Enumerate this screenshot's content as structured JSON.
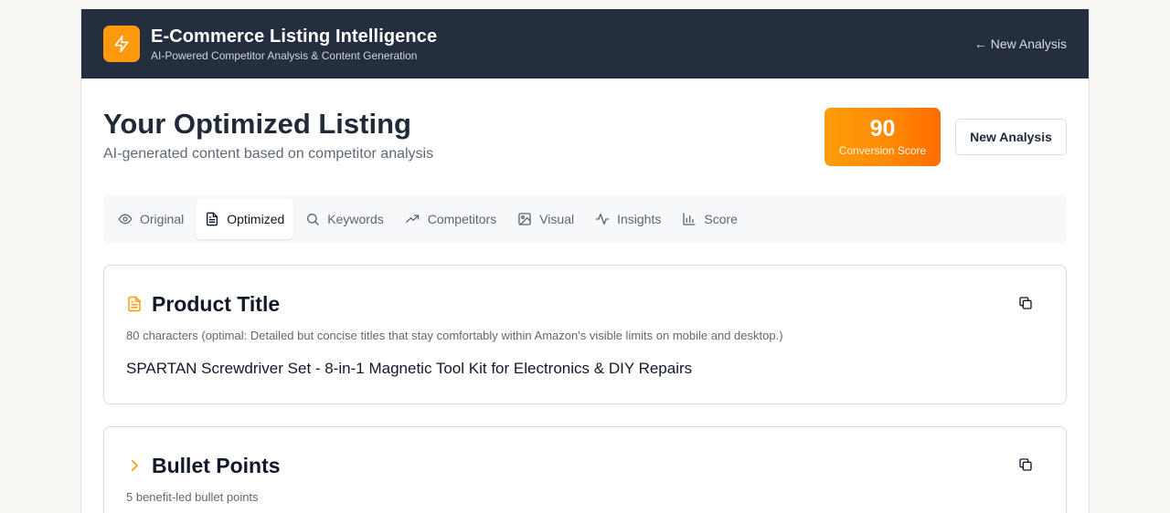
{
  "header": {
    "title": "E-Commerce Listing Intelligence",
    "subtitle": "AI-Powered Competitor Analysis & Content Generation",
    "back_link": "← New Analysis",
    "logo_icon": "lightning-icon"
  },
  "hero": {
    "title": "Your Optimized Listing",
    "subtitle": "AI-generated content based on competitor analysis",
    "score": {
      "value": "90",
      "label": "Conversion Score"
    },
    "new_analysis_button": "New Analysis"
  },
  "tabs": [
    {
      "label": "Original",
      "icon": "eye-icon",
      "active": false
    },
    {
      "label": "Optimized",
      "icon": "document-icon",
      "active": true
    },
    {
      "label": "Keywords",
      "icon": "search-icon",
      "active": false
    },
    {
      "label": "Competitors",
      "icon": "trending-up-icon",
      "active": false
    },
    {
      "label": "Visual",
      "icon": "image-icon",
      "active": false
    },
    {
      "label": "Insights",
      "icon": "activity-icon",
      "active": false
    },
    {
      "label": "Score",
      "icon": "bar-chart-icon",
      "active": false
    }
  ],
  "product_title_card": {
    "heading": "Product Title",
    "meta": "80 characters (optimal: Detailed but concise titles that stay comfortably within Amazon's visible limits on mobile and desktop.)",
    "value": "SPARTAN Screwdriver Set - 8-in-1 Magnetic Tool Kit for Electronics & DIY Repairs"
  },
  "bullet_points_card": {
    "heading": "Bullet Points",
    "meta": "5 benefit-led bullet points"
  },
  "colors": {
    "accent": "#ff9a0e",
    "header_bg": "#252e3f"
  }
}
